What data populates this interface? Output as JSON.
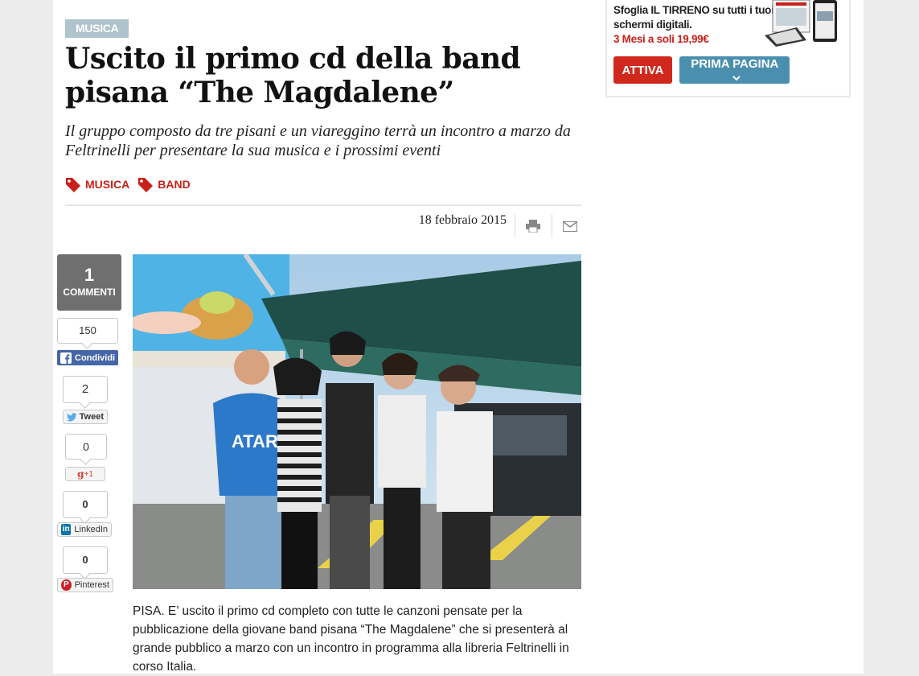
{
  "article": {
    "section": "MUSICA",
    "headline": "Uscito il primo cd della band pisana “The Magdalene”",
    "subtitle": "Il gruppo composto da tre pisani e un viareggino terrà un incontro a marzo da Feltrinelli per presentare la sua musica e i prossimi eventi",
    "tags": [
      "MUSICA",
      "BAND"
    ],
    "date": "18 febbraio 2015",
    "body": "PISA. E’ uscito il primo cd completo con tutte le canzoni pensate per la pubblicazione della giovane band pisana “The Magdalene” che si presenterà al grande pubblico a marzo con un incontro in programma alla libreria Feltrinelli in corso Italia."
  },
  "social": {
    "comments_count": "1",
    "comments_label": "COMMENTI",
    "facebook": {
      "count": "150",
      "label": "Condividi"
    },
    "twitter": {
      "count": "2",
      "label": "Tweet"
    },
    "googleplus": {
      "count": "0",
      "label": "+1"
    },
    "linkedin": {
      "count": "0",
      "label": "LinkedIn"
    },
    "pinterest": {
      "count": "0",
      "label": "Pinterest"
    }
  },
  "promo": {
    "text": "Sfoglia IL TIRRENO su tutti i tuoi schermi digitali.",
    "price": "3 Mesi a soli 19,99€",
    "attiva_label": "ATTIVA",
    "prima_pagina_label": "PRIMA PAGINA"
  },
  "photo_signs": {
    "shirt_text": "ATAR"
  },
  "colors": {
    "accent_red": "#c8211a",
    "label_blue": "#aec3cc",
    "facebook": "#4566a8",
    "button_blue": "#4b8fae"
  }
}
